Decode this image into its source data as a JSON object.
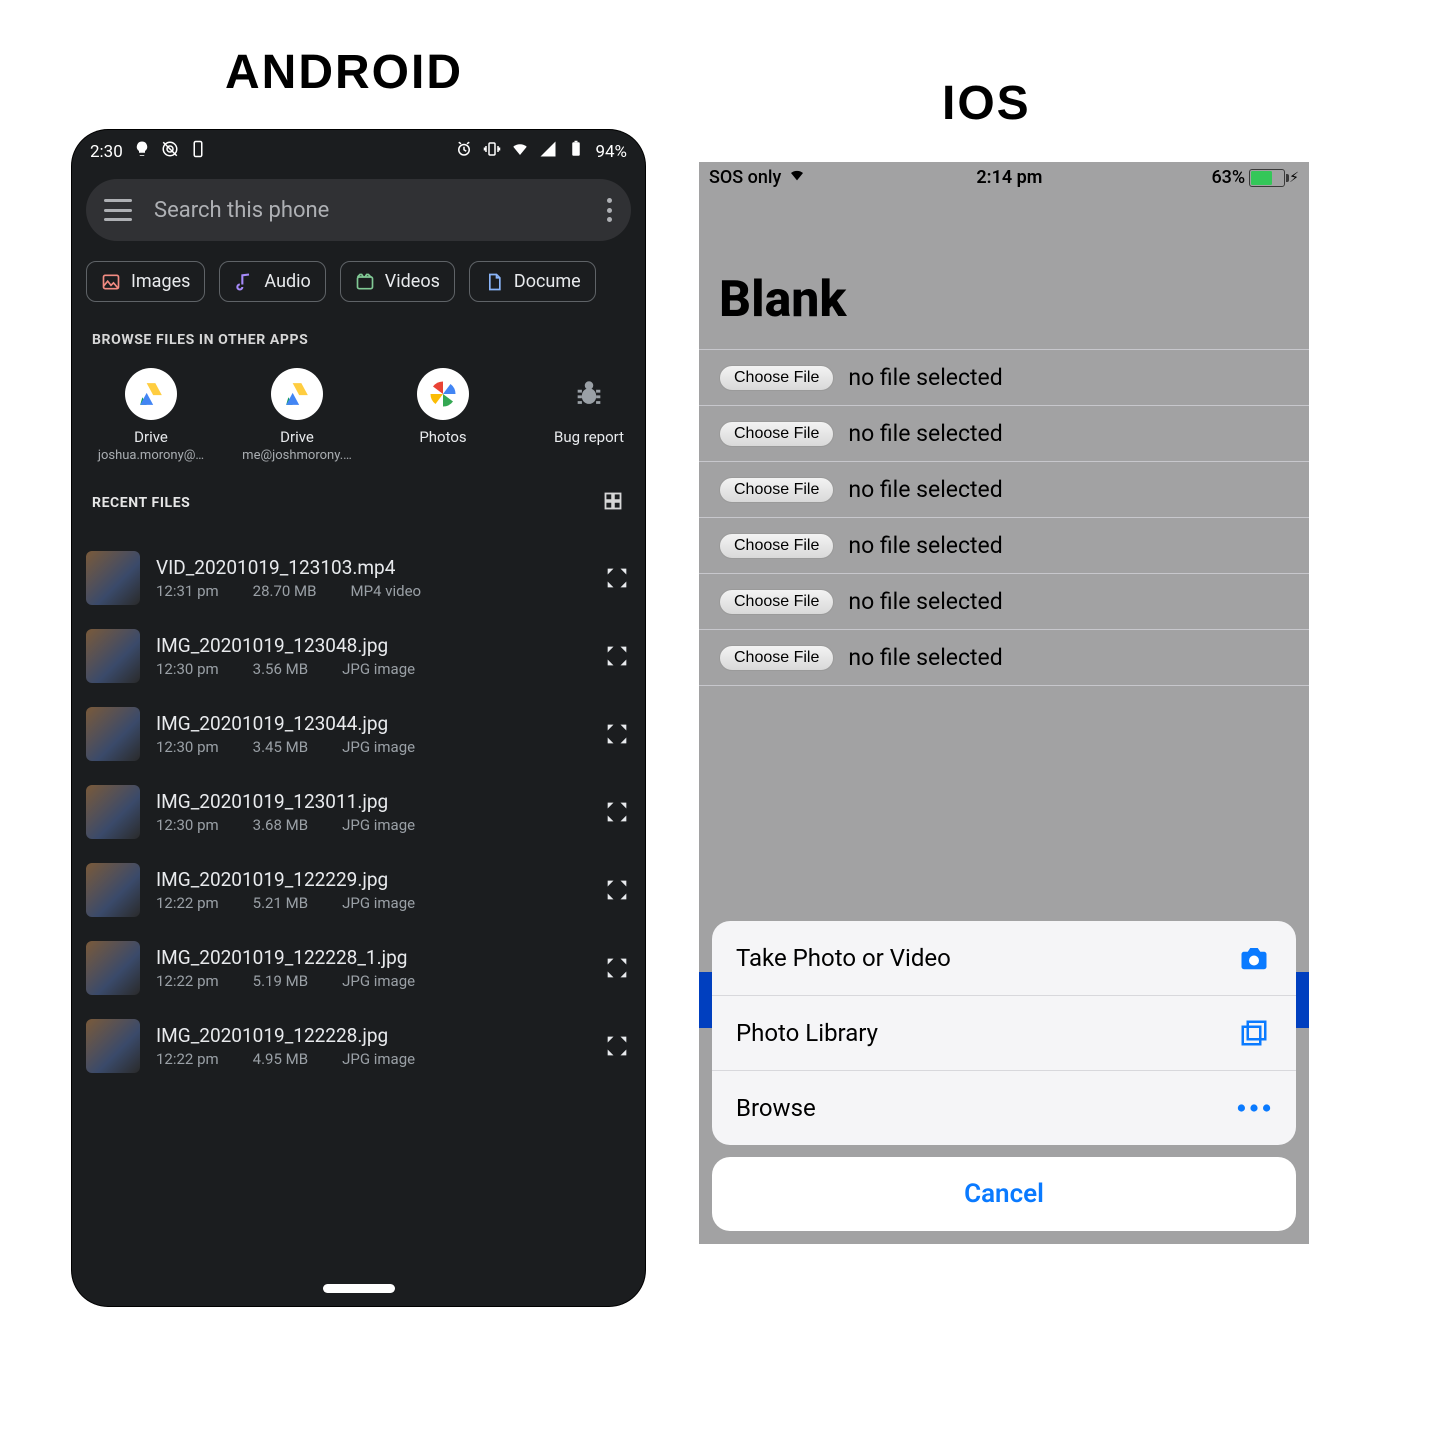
{
  "titles": {
    "android": "ANDROID",
    "ios": "IOS"
  },
  "android": {
    "status": {
      "time": "2:30",
      "battery": "94%"
    },
    "search_placeholder": "Search this phone",
    "chips": [
      {
        "label": "Images",
        "color": "#f28b82"
      },
      {
        "label": "Audio",
        "color": "#a78bfa"
      },
      {
        "label": "Videos",
        "color": "#81c995"
      },
      {
        "label": "Docume",
        "color": "#8ab4f8"
      }
    ],
    "browse_label": "BROWSE FILES IN OTHER APPS",
    "apps": [
      {
        "name": "Drive",
        "sub": "joshua.morony@…",
        "kind": "drive"
      },
      {
        "name": "Drive",
        "sub": "me@joshmorony.…",
        "kind": "drive"
      },
      {
        "name": "Photos",
        "sub": "",
        "kind": "photos"
      },
      {
        "name": "Bug report",
        "sub": "",
        "kind": "bug"
      }
    ],
    "recent_label": "RECENT FILES",
    "files": [
      {
        "name": "VID_20201019_123103.mp4",
        "time": "12:31 pm",
        "size": "28.70 MB",
        "type": "MP4 video"
      },
      {
        "name": "IMG_20201019_123048.jpg",
        "time": "12:30 pm",
        "size": "3.56 MB",
        "type": "JPG image"
      },
      {
        "name": "IMG_20201019_123044.jpg",
        "time": "12:30 pm",
        "size": "3.45 MB",
        "type": "JPG image"
      },
      {
        "name": "IMG_20201019_123011.jpg",
        "time": "12:30 pm",
        "size": "3.68 MB",
        "type": "JPG image"
      },
      {
        "name": "IMG_20201019_122229.jpg",
        "time": "12:22 pm",
        "size": "5.21 MB",
        "type": "JPG image"
      },
      {
        "name": "IMG_20201019_122228_1.jpg",
        "time": "12:22 pm",
        "size": "5.19 MB",
        "type": "JPG image"
      },
      {
        "name": "IMG_20201019_122228.jpg",
        "time": "12:22 pm",
        "size": "4.95 MB",
        "type": "JPG image"
      }
    ]
  },
  "ios": {
    "status": {
      "carrier": "SOS only",
      "time": "2:14 pm",
      "battery": "63%"
    },
    "heading": "Blank",
    "choose_label": "Choose File",
    "no_file": "no file selected",
    "row_count": 6,
    "sheet": {
      "items": [
        {
          "label": "Take Photo or Video",
          "icon": "camera"
        },
        {
          "label": "Photo Library",
          "icon": "library"
        },
        {
          "label": "Browse",
          "icon": "more"
        }
      ],
      "cancel": "Cancel"
    }
  }
}
